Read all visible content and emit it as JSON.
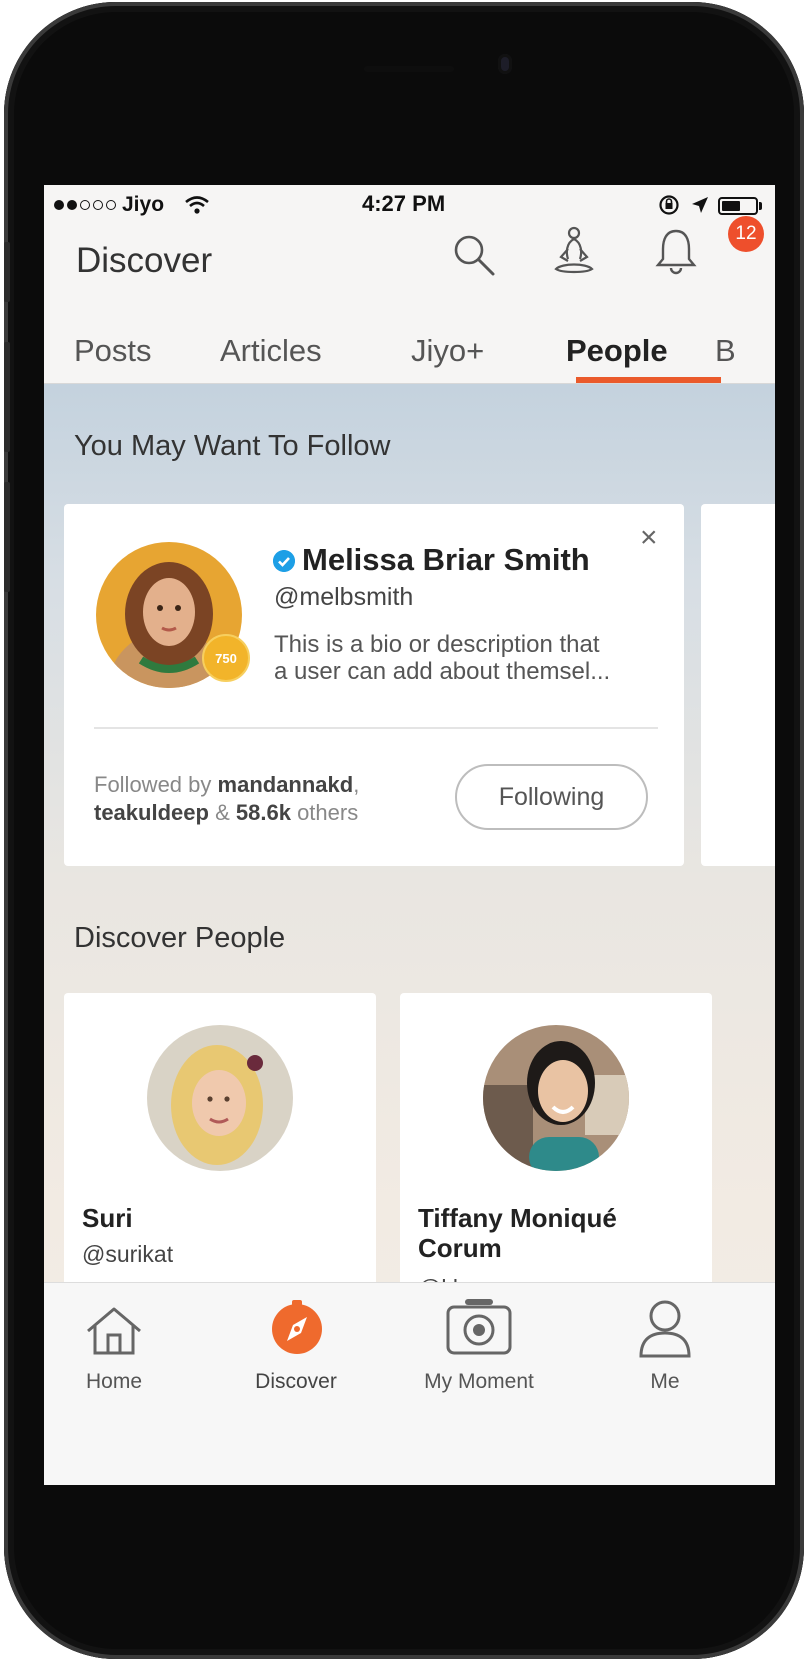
{
  "status_bar": {
    "carrier": "Jiyo",
    "time": "4:27 PM"
  },
  "header": {
    "title": "Discover",
    "notification_count": "12"
  },
  "tabs": [
    {
      "label": "Posts",
      "active": false
    },
    {
      "label": "Articles",
      "active": false
    },
    {
      "label": "Jiyo+",
      "active": false
    },
    {
      "label": "People",
      "active": true
    },
    {
      "label": "B",
      "active": false
    }
  ],
  "follow_section": {
    "title": "You May Want To Follow",
    "card": {
      "name": "Melissa Briar Smith",
      "handle": "@melbsmith",
      "bio_line1": "This is a bio or description that",
      "bio_line2": "a user can add about themsel...",
      "medal_value": "750",
      "close_symbol": "×",
      "followed_prefix": "Followed by",
      "followed_user1": "mandannakd",
      "followed_comma": ",",
      "followed_user2": "teakuldeep",
      "followed_amp": "&",
      "followed_count": "58.6k",
      "followed_suffix": "others",
      "button_label": "Following"
    }
  },
  "discover_section": {
    "title": "Discover People",
    "people": [
      {
        "name": "Suri",
        "handle": "@surikat"
      },
      {
        "name_line1": "Tiffany Moniqué",
        "name_line2": "Corum",
        "handle": "@kkz_yoga"
      }
    ]
  },
  "bottom_nav": [
    {
      "label": "Home",
      "icon": "home-icon"
    },
    {
      "label": "Discover",
      "icon": "compass-icon",
      "active": true
    },
    {
      "label": "My Moment",
      "icon": "camera-icon"
    },
    {
      "label": "Me",
      "icon": "person-icon"
    }
  ],
  "colors": {
    "accent": "#ea5a2b",
    "badge": "#ee4f2c",
    "verified": "#1d9fe6",
    "medal": "#f2b42a"
  }
}
